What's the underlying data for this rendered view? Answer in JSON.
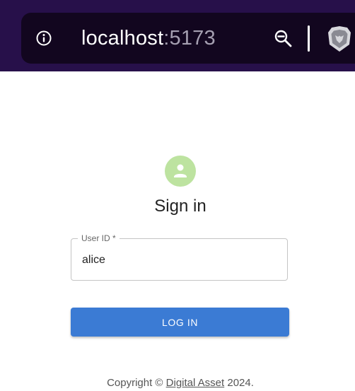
{
  "browser": {
    "url_host": "localhost",
    "url_port": ":5173",
    "icons": [
      "info-icon",
      "zoom-out-icon",
      "brave-shield-icon"
    ]
  },
  "form": {
    "avatar_icon": "person-icon",
    "title": "Sign in",
    "user_id_label": "User ID *",
    "user_id_value": "alice",
    "login_button": "LOG IN"
  },
  "footer": {
    "prefix": "Copyright © ",
    "link": "Digital Asset",
    "suffix": " 2024."
  },
  "colors": {
    "browser_bar": "#27104a",
    "address_pill": "#12061f",
    "avatar_bg": "#bde3a0",
    "button_bg": "#3b7bd4"
  }
}
